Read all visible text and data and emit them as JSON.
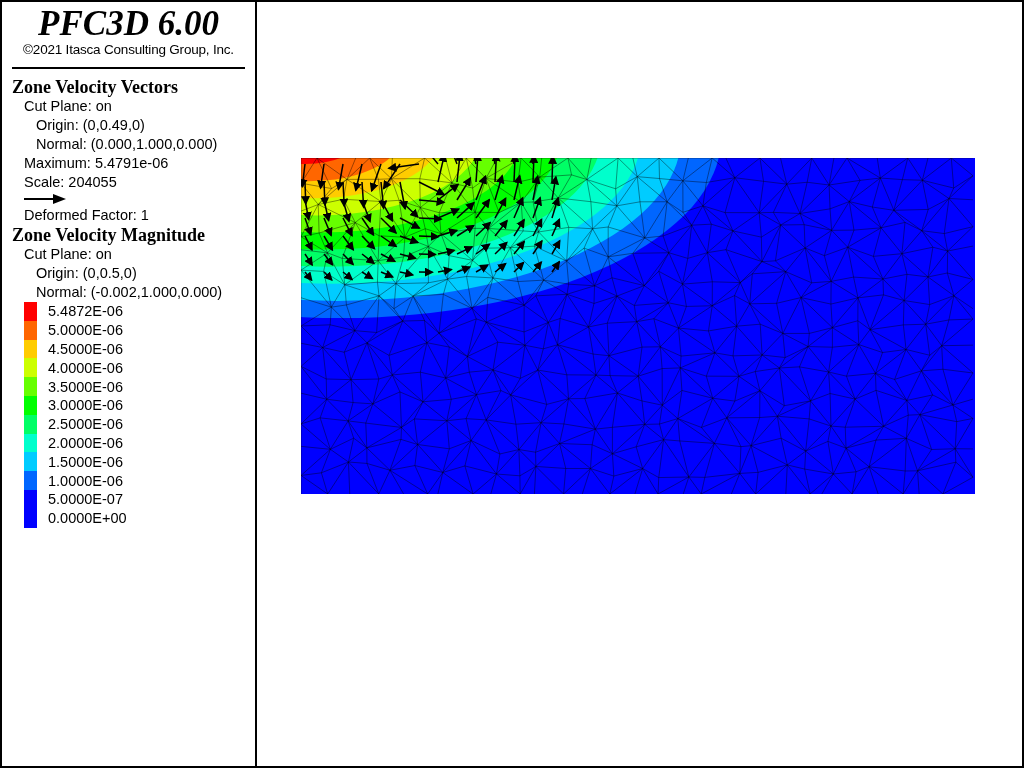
{
  "title": "PFC3D 6.00",
  "copyright": "©2021 Itasca Consulting Group, Inc.",
  "sections": [
    {
      "heading": "Zone Velocity Vectors",
      "lines": [
        {
          "kind": "line",
          "text": "Cut Plane: on"
        },
        {
          "kind": "subline",
          "text": "Origin: (0,0.49,0)"
        },
        {
          "kind": "subline",
          "text": "Normal: (0.000,1.000,0.000)"
        },
        {
          "kind": "line",
          "text": "Maximum: 5.4791e-06"
        },
        {
          "kind": "line",
          "text": "Scale: 204055"
        },
        {
          "kind": "arrow"
        },
        {
          "kind": "line",
          "text": "Deformed Factor: 1"
        }
      ]
    },
    {
      "heading": "Zone Velocity Magnitude",
      "lines": [
        {
          "kind": "line",
          "text": "Cut Plane: on"
        },
        {
          "kind": "subline",
          "text": "Origin: (0,0.5,0)"
        },
        {
          "kind": "subline",
          "text": "Normal: (-0.002,1.000,0.000)"
        }
      ],
      "legend": [
        {
          "label": "5.4872E-06",
          "color": "#ff0000"
        },
        {
          "label": "5.0000E-06",
          "color": "#ff6600"
        },
        {
          "label": "4.5000E-06",
          "color": "#ffcc00"
        },
        {
          "label": "4.0000E-06",
          "color": "#ccff00"
        },
        {
          "label": "3.5000E-06",
          "color": "#66ff00"
        },
        {
          "label": "3.0000E-06",
          "color": "#00ff00"
        },
        {
          "label": "2.5000E-06",
          "color": "#00ff66"
        },
        {
          "label": "2.0000E-06",
          "color": "#00ffcc"
        },
        {
          "label": "1.5000E-06",
          "color": "#00ccff"
        },
        {
          "label": "1.0000E-06",
          "color": "#0066ff"
        },
        {
          "label": "5.0000E-07",
          "color": "#0000ff"
        },
        {
          "label": "0.0000E+00",
          "color": "#0000ff"
        }
      ]
    }
  ]
}
